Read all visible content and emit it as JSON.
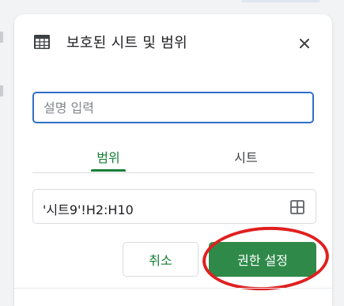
{
  "dialog": {
    "title": "보호된 시트 및 범위",
    "close_label": "×",
    "icons": {
      "header": "table-icon",
      "close": "close-icon",
      "range_picker": "grid-icon"
    },
    "description_input": {
      "value": "",
      "placeholder": "설명 입력"
    },
    "tabs": [
      {
        "label": "범위",
        "active": true
      },
      {
        "label": "시트",
        "active": false
      }
    ],
    "range_value": "'시트9'!H2:H10",
    "buttons": {
      "cancel": "취소",
      "confirm": "권한 설정"
    },
    "colors": {
      "accent_green": "#188038",
      "button_green": "#2f8a4a",
      "focus_blue": "#2f6fc9",
      "highlight_red": "#e01f1f"
    }
  }
}
